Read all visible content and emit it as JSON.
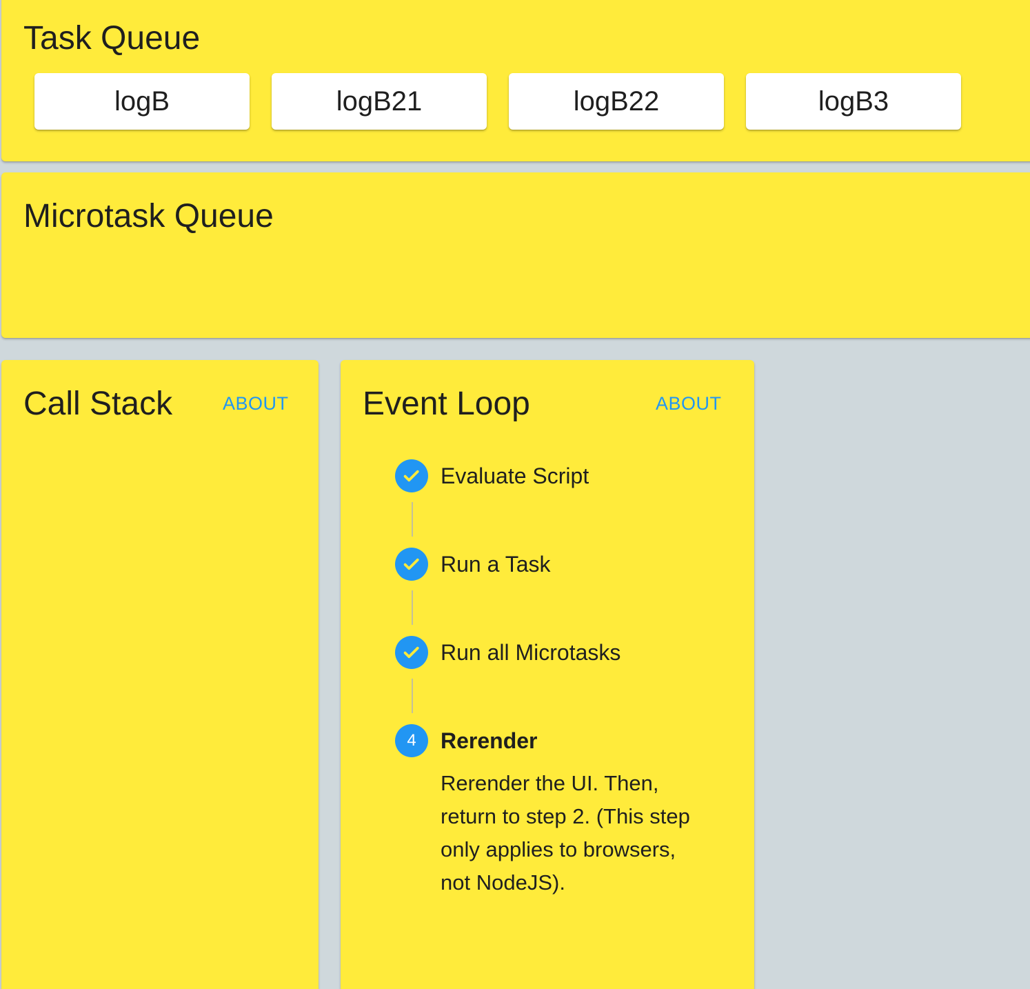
{
  "task_queue": {
    "title": "Task Queue",
    "tasks": [
      "logB",
      "logB21",
      "logB22",
      "logB3"
    ]
  },
  "microtask_queue": {
    "title": "Microtask Queue",
    "tasks": []
  },
  "call_stack": {
    "title": "Call Stack",
    "about_label": "ABOUT"
  },
  "event_loop": {
    "title": "Event Loop",
    "about_label": "ABOUT",
    "steps": [
      {
        "label": "Evaluate Script",
        "status": "completed",
        "icon": "check-icon"
      },
      {
        "label": "Run a Task",
        "status": "completed",
        "icon": "check-icon"
      },
      {
        "label": "Run all Microtasks",
        "status": "completed",
        "icon": "check-icon"
      },
      {
        "label": "Rerender",
        "status": "active",
        "number": "4",
        "description": "Rerender the UI. Then, return to step 2. (This step only applies to browsers, not NodeJS)."
      }
    ]
  },
  "colors": {
    "card_background": "#ffeb3b",
    "page_background": "#cfd8dc",
    "accent": "#2196f3",
    "chip_background": "#ffffff"
  }
}
